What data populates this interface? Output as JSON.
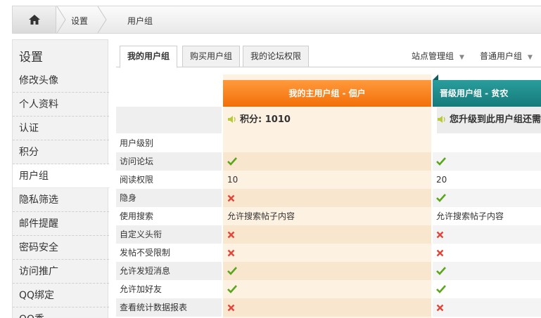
{
  "breadcrumb": {
    "items": [
      "设置",
      "用户组"
    ]
  },
  "sidebar": {
    "title": "设置",
    "items": [
      {
        "label": "修改头像"
      },
      {
        "label": "个人资料"
      },
      {
        "label": "认证"
      },
      {
        "label": "积分"
      },
      {
        "label": "用户组",
        "active": true
      },
      {
        "label": "隐私筛选"
      },
      {
        "label": "邮件提醒"
      },
      {
        "label": "密码安全"
      },
      {
        "label": "访问推广"
      },
      {
        "label": "QQ绑定"
      },
      {
        "label": "QQ秀"
      }
    ]
  },
  "tabs": [
    {
      "label": "我的用户组",
      "active": true
    },
    {
      "label": "购买用户组"
    },
    {
      "label": "我的论坛权限"
    }
  ],
  "dropdowns": [
    "站点管理组",
    "普通用户组"
  ],
  "table": {
    "col1_header": "我的主用户组 - 佃户",
    "col2_header": "晋级用户组 - 贫农",
    "col1_score": "积分: 1010",
    "col2_score": "您升级到此用户组还需",
    "rows": [
      {
        "label": "用户级别",
        "c1": "",
        "c2": ""
      },
      {
        "label": "访问论坛",
        "c1": "check",
        "c2": "check"
      },
      {
        "label": "阅读权限",
        "c1": "10",
        "c2": "20"
      },
      {
        "label": "隐身",
        "c1": "cross",
        "c2": "check"
      },
      {
        "label": "使用搜索",
        "c1": "允许搜索帖子内容",
        "c2": "允许搜索帖子内容"
      },
      {
        "label": "自定义头衔",
        "c1": "cross",
        "c2": "cross"
      },
      {
        "label": "发帖不受限制",
        "c1": "cross",
        "c2": "cross"
      },
      {
        "label": "允许发短消息",
        "c1": "check",
        "c2": "check"
      },
      {
        "label": "允许加好友",
        "c1": "check",
        "c2": "check"
      },
      {
        "label": "查看统计数据报表",
        "c1": "cross",
        "c2": "cross"
      }
    ]
  },
  "colors": {
    "orange_header": "#f26f08",
    "teal_header": "#167a7a",
    "check": "#5aa51c",
    "cross": "#e0463a"
  }
}
